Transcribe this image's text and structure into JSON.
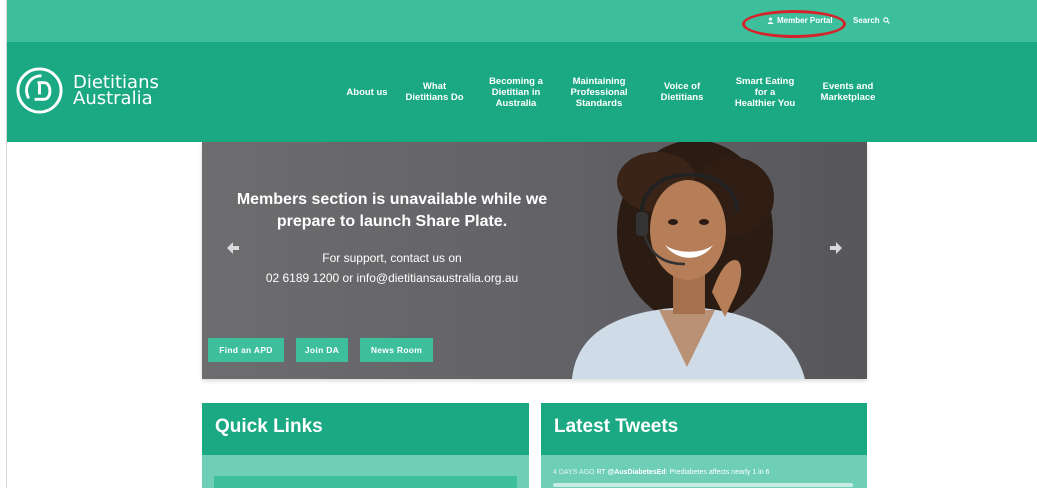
{
  "header": {
    "member_portal": "Member Portal",
    "search": "Search"
  },
  "logo": {
    "line1": "Dietitians",
    "line2": "Australia"
  },
  "nav": {
    "items": [
      {
        "label": "About us"
      },
      {
        "label": "What\nDietitians Do"
      },
      {
        "label": "Becoming a\nDietitian in\nAustralia"
      },
      {
        "label": "Maintaining\nProfessional\nStandards"
      },
      {
        "label": "Voice of\nDietitians"
      },
      {
        "label": "Smart Eating\nfor a\nHealthier You"
      },
      {
        "label": "Events and\nMarketplace"
      }
    ]
  },
  "hero": {
    "headline": "Members section is unavailable while we prepare to launch Share Plate.",
    "sub_line1": "For support, contact us on",
    "sub_line2": "02 6189 1200 or info@dietitiansaustralia.org.au",
    "buttons": [
      {
        "label": "Find an APD"
      },
      {
        "label": "Join DA"
      },
      {
        "label": "News Room"
      }
    ]
  },
  "quick_links": {
    "title": "Quick Links"
  },
  "latest_tweets": {
    "title": "Latest Tweets",
    "tweet_time": "4 DAYS AGO",
    "tweet_prefix": "RT",
    "tweet_handle": "@AusDiabetesEd",
    "tweet_text": ": Prediabetes affects nearly 1 in 6"
  },
  "colors": {
    "utility_bar": "#3dbf9c",
    "nav_bar": "#1aa983",
    "button": "#3dbf9c",
    "highlight": "#d6232a"
  }
}
